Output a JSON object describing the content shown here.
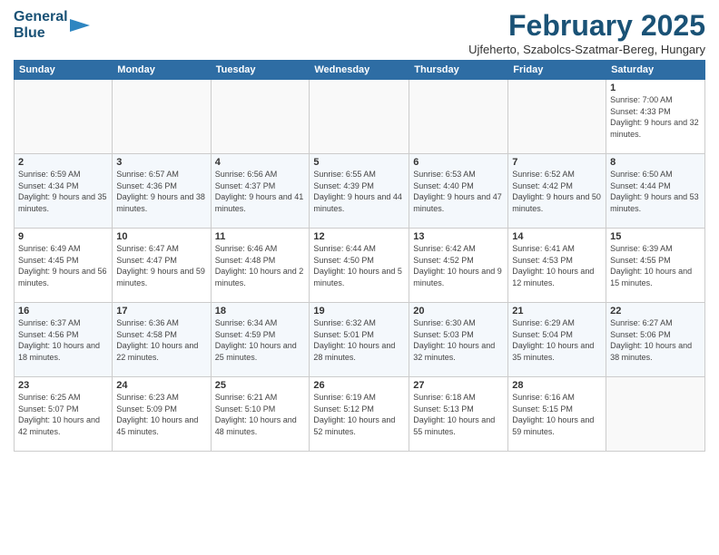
{
  "header": {
    "logo_line1": "General",
    "logo_line2": "Blue",
    "month_title": "February 2025",
    "subtitle": "Ujfeherto, Szabolcs-Szatmar-Bereg, Hungary"
  },
  "weekdays": [
    "Sunday",
    "Monday",
    "Tuesday",
    "Wednesday",
    "Thursday",
    "Friday",
    "Saturday"
  ],
  "weeks": [
    [
      {
        "day": "",
        "info": ""
      },
      {
        "day": "",
        "info": ""
      },
      {
        "day": "",
        "info": ""
      },
      {
        "day": "",
        "info": ""
      },
      {
        "day": "",
        "info": ""
      },
      {
        "day": "",
        "info": ""
      },
      {
        "day": "1",
        "info": "Sunrise: 7:00 AM\nSunset: 4:33 PM\nDaylight: 9 hours and 32 minutes."
      }
    ],
    [
      {
        "day": "2",
        "info": "Sunrise: 6:59 AM\nSunset: 4:34 PM\nDaylight: 9 hours and 35 minutes."
      },
      {
        "day": "3",
        "info": "Sunrise: 6:57 AM\nSunset: 4:36 PM\nDaylight: 9 hours and 38 minutes."
      },
      {
        "day": "4",
        "info": "Sunrise: 6:56 AM\nSunset: 4:37 PM\nDaylight: 9 hours and 41 minutes."
      },
      {
        "day": "5",
        "info": "Sunrise: 6:55 AM\nSunset: 4:39 PM\nDaylight: 9 hours and 44 minutes."
      },
      {
        "day": "6",
        "info": "Sunrise: 6:53 AM\nSunset: 4:40 PM\nDaylight: 9 hours and 47 minutes."
      },
      {
        "day": "7",
        "info": "Sunrise: 6:52 AM\nSunset: 4:42 PM\nDaylight: 9 hours and 50 minutes."
      },
      {
        "day": "8",
        "info": "Sunrise: 6:50 AM\nSunset: 4:44 PM\nDaylight: 9 hours and 53 minutes."
      }
    ],
    [
      {
        "day": "9",
        "info": "Sunrise: 6:49 AM\nSunset: 4:45 PM\nDaylight: 9 hours and 56 minutes."
      },
      {
        "day": "10",
        "info": "Sunrise: 6:47 AM\nSunset: 4:47 PM\nDaylight: 9 hours and 59 minutes."
      },
      {
        "day": "11",
        "info": "Sunrise: 6:46 AM\nSunset: 4:48 PM\nDaylight: 10 hours and 2 minutes."
      },
      {
        "day": "12",
        "info": "Sunrise: 6:44 AM\nSunset: 4:50 PM\nDaylight: 10 hours and 5 minutes."
      },
      {
        "day": "13",
        "info": "Sunrise: 6:42 AM\nSunset: 4:52 PM\nDaylight: 10 hours and 9 minutes."
      },
      {
        "day": "14",
        "info": "Sunrise: 6:41 AM\nSunset: 4:53 PM\nDaylight: 10 hours and 12 minutes."
      },
      {
        "day": "15",
        "info": "Sunrise: 6:39 AM\nSunset: 4:55 PM\nDaylight: 10 hours and 15 minutes."
      }
    ],
    [
      {
        "day": "16",
        "info": "Sunrise: 6:37 AM\nSunset: 4:56 PM\nDaylight: 10 hours and 18 minutes."
      },
      {
        "day": "17",
        "info": "Sunrise: 6:36 AM\nSunset: 4:58 PM\nDaylight: 10 hours and 22 minutes."
      },
      {
        "day": "18",
        "info": "Sunrise: 6:34 AM\nSunset: 4:59 PM\nDaylight: 10 hours and 25 minutes."
      },
      {
        "day": "19",
        "info": "Sunrise: 6:32 AM\nSunset: 5:01 PM\nDaylight: 10 hours and 28 minutes."
      },
      {
        "day": "20",
        "info": "Sunrise: 6:30 AM\nSunset: 5:03 PM\nDaylight: 10 hours and 32 minutes."
      },
      {
        "day": "21",
        "info": "Sunrise: 6:29 AM\nSunset: 5:04 PM\nDaylight: 10 hours and 35 minutes."
      },
      {
        "day": "22",
        "info": "Sunrise: 6:27 AM\nSunset: 5:06 PM\nDaylight: 10 hours and 38 minutes."
      }
    ],
    [
      {
        "day": "23",
        "info": "Sunrise: 6:25 AM\nSunset: 5:07 PM\nDaylight: 10 hours and 42 minutes."
      },
      {
        "day": "24",
        "info": "Sunrise: 6:23 AM\nSunset: 5:09 PM\nDaylight: 10 hours and 45 minutes."
      },
      {
        "day": "25",
        "info": "Sunrise: 6:21 AM\nSunset: 5:10 PM\nDaylight: 10 hours and 48 minutes."
      },
      {
        "day": "26",
        "info": "Sunrise: 6:19 AM\nSunset: 5:12 PM\nDaylight: 10 hours and 52 minutes."
      },
      {
        "day": "27",
        "info": "Sunrise: 6:18 AM\nSunset: 5:13 PM\nDaylight: 10 hours and 55 minutes."
      },
      {
        "day": "28",
        "info": "Sunrise: 6:16 AM\nSunset: 5:15 PM\nDaylight: 10 hours and 59 minutes."
      },
      {
        "day": "",
        "info": ""
      }
    ]
  ]
}
